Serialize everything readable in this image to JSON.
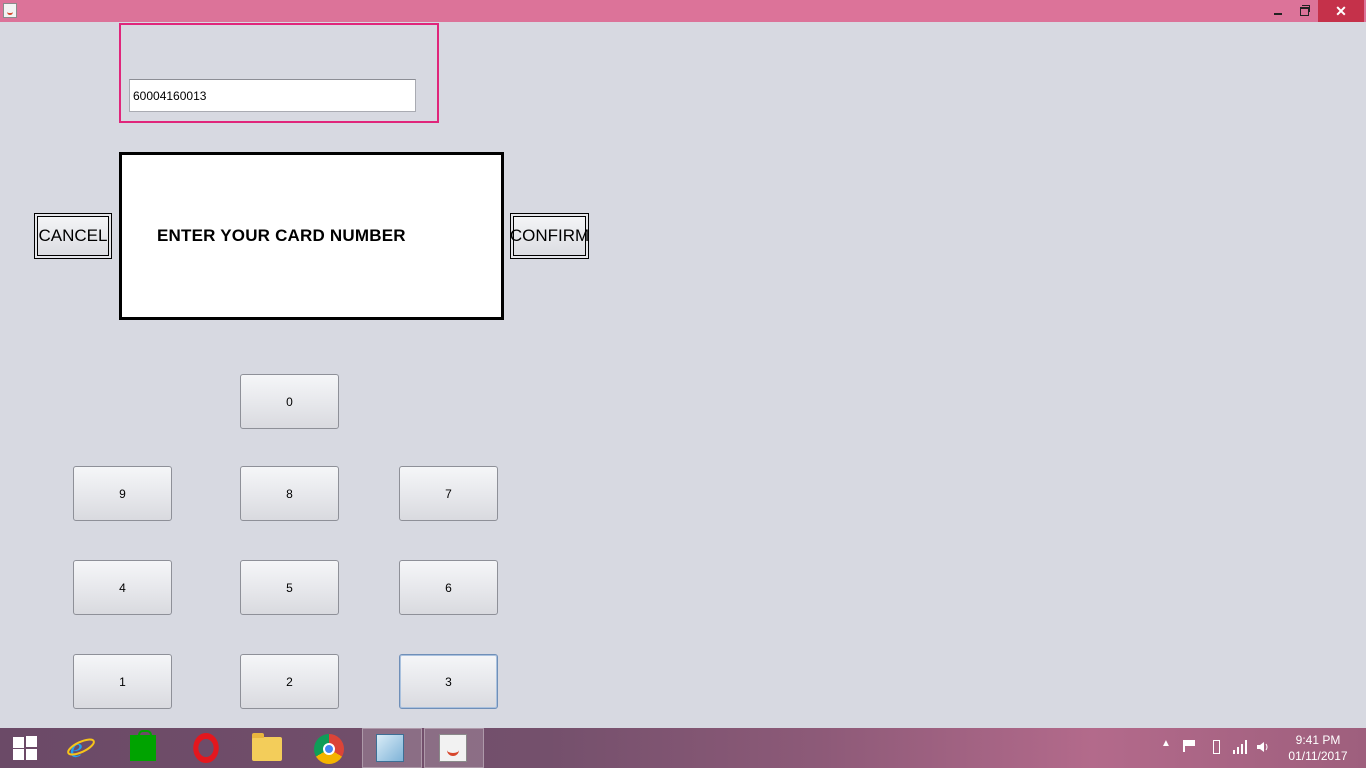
{
  "window": {
    "icon": "java-app-icon",
    "title_color": "#dc7399",
    "controls": {
      "minimize": "minimize-icon",
      "restore": "restore-icon",
      "close": "✕"
    }
  },
  "card_input": {
    "value": "60004160013"
  },
  "screen": {
    "message": "ENTER YOUR CARD NUMBER"
  },
  "buttons": {
    "cancel": "CANCEL",
    "confirm": "CONFIRM"
  },
  "keypad": {
    "k0": "0",
    "k9": "9",
    "k8": "8",
    "k7": "7",
    "k4": "4",
    "k5": "5",
    "k6": "6",
    "k1": "1",
    "k2": "2",
    "k3": "3",
    "focused": "3"
  },
  "taskbar": {
    "apps": [
      "start-icon",
      "internet-explorer-icon",
      "store-icon",
      "opera-icon",
      "file-explorer-icon",
      "chrome-icon",
      "virtualbox-icon",
      "java-icon"
    ],
    "active_app": "java-icon",
    "clock_time": "9:41 PM",
    "clock_date": "01/11/2017"
  }
}
